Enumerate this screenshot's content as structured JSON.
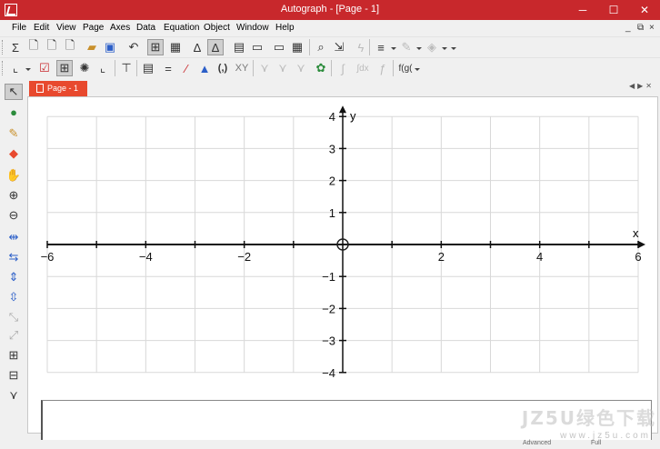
{
  "window": {
    "title": "Autograph - [Page - 1]"
  },
  "colors": {
    "accent": "#c8282c",
    "tab": "#e8492e"
  },
  "menu": {
    "items": [
      "File",
      "Edit",
      "View",
      "Page",
      "Axes",
      "Data",
      "Equation",
      "Object",
      "Window",
      "Help"
    ],
    "mdi_controls": [
      "_",
      "⧉",
      "×"
    ]
  },
  "toolbar1": {
    "icons": [
      "sigma-icon",
      "new-page-icon",
      "new-2d-page-icon",
      "new-3d-page-icon",
      "open-folder-icon",
      "save-icon",
      "undo-icon",
      "graph-page-icon",
      "statistics-page-icon",
      "slow-plot-icon",
      "fast-plot-icon",
      "table-icon",
      "text-box-icon",
      "calculator-icon",
      "table-of-values-icon",
      "zoom-fit-icon",
      "line-style-icon",
      "pen-icon",
      "fill-icon"
    ]
  },
  "toolbar2": {
    "icons": [
      "point-select-icon",
      "checkbox-icon",
      "grid-icon",
      "polar-grid-icon",
      "axes-icon",
      "text-icon",
      "add-point-icon",
      "add-equation-icon",
      "add-line-icon",
      "add-vector-icon",
      "coordinates-icon",
      "xy-icon",
      "transform-icon",
      "turtle-icon",
      "tangent-icon",
      "integral-icon",
      "derivative-icon",
      "function-icon"
    ],
    "coords_label": "(,)",
    "xy_label": "XY",
    "fx_label": "f(g(",
    "integral_label": "∫dx"
  },
  "left_tools": [
    "select-arrow-icon",
    "add-point-tool-icon",
    "pen-tool-icon",
    "eraser-tool-icon",
    "hand-tool-icon",
    "zoom-in-icon",
    "zoom-out-icon",
    "x-stretch-icon",
    "x-squash-icon",
    "y-stretch-icon",
    "y-squash-icon",
    "diagonal-stretch-icon",
    "diagonal-squash-icon",
    "zoom-box-in-icon",
    "zoom-box-out-icon",
    "slider-icon"
  ],
  "tabs": [
    {
      "label": "Page - 1"
    }
  ],
  "graph": {
    "x_axis_label": "x",
    "y_axis_label": "y",
    "x_range": [
      -6,
      6
    ],
    "y_range": [
      -4,
      4
    ],
    "x_ticks": [
      -6,
      -4,
      -2,
      2,
      4,
      6
    ],
    "y_ticks": [
      4,
      3,
      2,
      1,
      -1,
      -2,
      -3,
      -4
    ],
    "grid": true,
    "grid_x_lines": [
      -6,
      -5,
      -4,
      -3,
      -2,
      -1,
      0,
      1,
      2,
      3,
      4,
      5,
      6
    ],
    "grid_y_lines": [
      -4,
      -3,
      -2,
      -1,
      0,
      1,
      2,
      3,
      4
    ]
  },
  "status": {
    "mode": "Advanced",
    "zoom": "Full"
  },
  "watermark": {
    "main": "JZ5U绿色下载",
    "sub": "www.jz5u.com"
  }
}
